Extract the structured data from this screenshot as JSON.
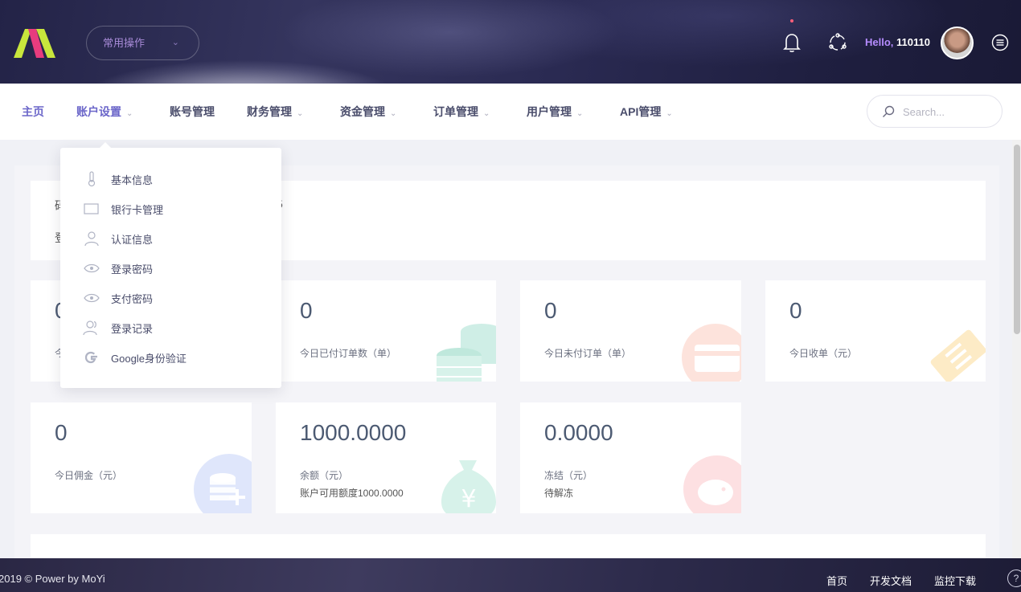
{
  "header": {
    "quick_ops_label": "常用操作",
    "hello_prefix": "Hello,",
    "username": "110110"
  },
  "nav": {
    "items": [
      {
        "label": "主页",
        "has_menu": false
      },
      {
        "label": "账户设置",
        "has_menu": true
      },
      {
        "label": "账号管理",
        "has_menu": false
      },
      {
        "label": "财务管理",
        "has_menu": true
      },
      {
        "label": "资金管理",
        "has_menu": true
      },
      {
        "label": "订单管理",
        "has_menu": true
      },
      {
        "label": "用户管理",
        "has_menu": true
      },
      {
        "label": "API管理",
        "has_menu": true
      }
    ],
    "search_placeholder": "Search..."
  },
  "dropdown": {
    "items": [
      {
        "label": "基本信息",
        "icon": "thermometer-icon"
      },
      {
        "label": "银行卡管理",
        "icon": "card-icon"
      },
      {
        "label": "认证信息",
        "icon": "user-icon"
      },
      {
        "label": "登录密码",
        "icon": "eye-icon"
      },
      {
        "label": "支付密码",
        "icon": "eye-icon"
      },
      {
        "label": "登录记录",
        "icon": "users-icon"
      },
      {
        "label": "Google身份验证",
        "icon": "google-icon"
      }
    ]
  },
  "notice": {
    "line1": "码",
    "line1_suffix": "5",
    "line2": "登"
  },
  "cards": [
    {
      "value": "0",
      "label": "今",
      "icon": "hidden"
    },
    {
      "value": "0",
      "label": "今日已付订单数（单）",
      "icon": "coins-icon",
      "color": "#cfeee6"
    },
    {
      "value": "0",
      "label": "今日未付订单（单）",
      "icon": "wallet-icon",
      "color": "#fde3dc"
    },
    {
      "value": "0",
      "label": "今日收单（元）",
      "icon": "ticket-icon",
      "color": "#fdebc6"
    },
    {
      "value": "0",
      "label": "今日佣金（元）",
      "icon": "database-add-icon",
      "color": "#dfe6fb"
    },
    {
      "value": "1000.0000",
      "label": "余额（元）",
      "sub": "账户可用额度1000.0000",
      "icon": "money-bag-icon",
      "color": "#d7f2ea"
    },
    {
      "value": "0.0000",
      "label": "冻结（元）",
      "sub": "待解冻",
      "icon": "piggy-bank-icon",
      "color": "#fde0e2"
    }
  ],
  "footer": {
    "copyright": "2019 © Power by MoYi",
    "links": [
      "首页",
      "开发文档",
      "监控下载"
    ],
    "help": "?"
  },
  "colors": {
    "accent": "#6b66c9",
    "hello": "#b58cff"
  }
}
